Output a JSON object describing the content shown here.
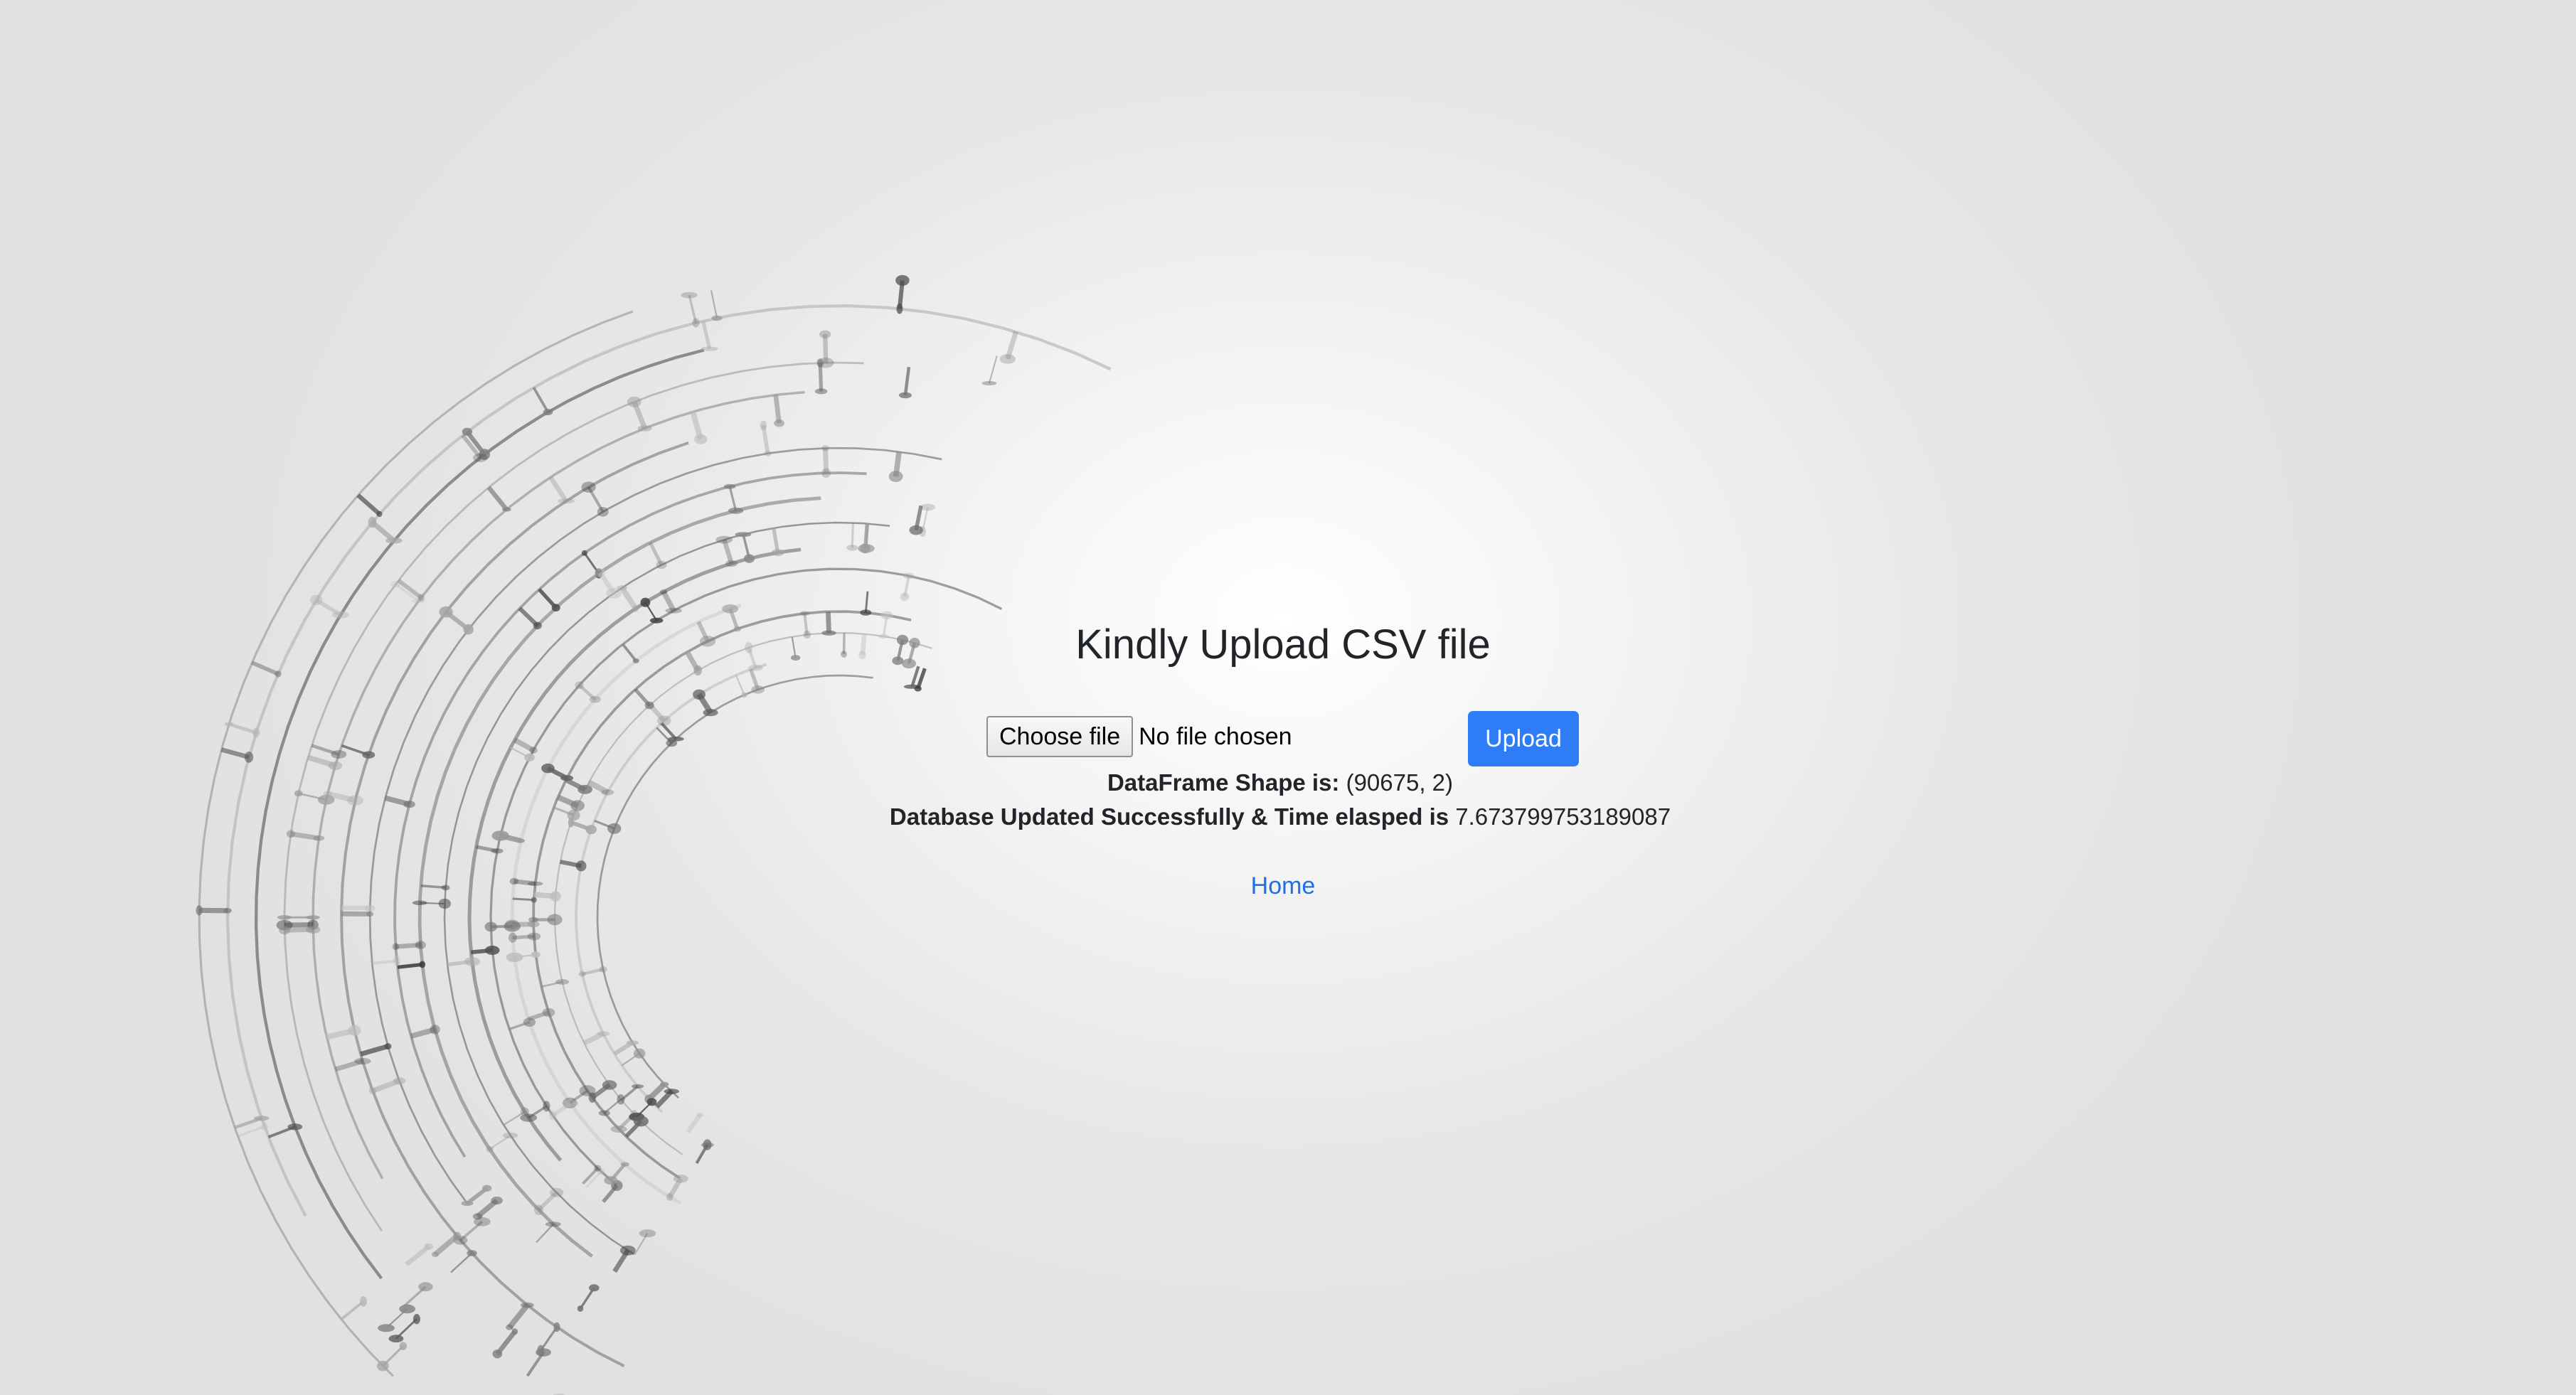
{
  "heading": "Kindly Upload CSV file",
  "file_input": {
    "button_label": "Choose file",
    "status": "No file chosen"
  },
  "upload_button": "Upload",
  "shape_line": {
    "label": "DataFrame Shape is:",
    "value": "(90675, 2)"
  },
  "db_line": {
    "label": "Database Updated Successfully & Time elasped is",
    "value": "7.673799753189087"
  },
  "home_link": "Home",
  "background": {
    "decoration": "circuit-arc-icon"
  },
  "colors": {
    "primary_button": "#2f7df6",
    "link": "#1f6fe5",
    "background_center": "#ffffff",
    "background_edge": "#e1e1e1"
  }
}
